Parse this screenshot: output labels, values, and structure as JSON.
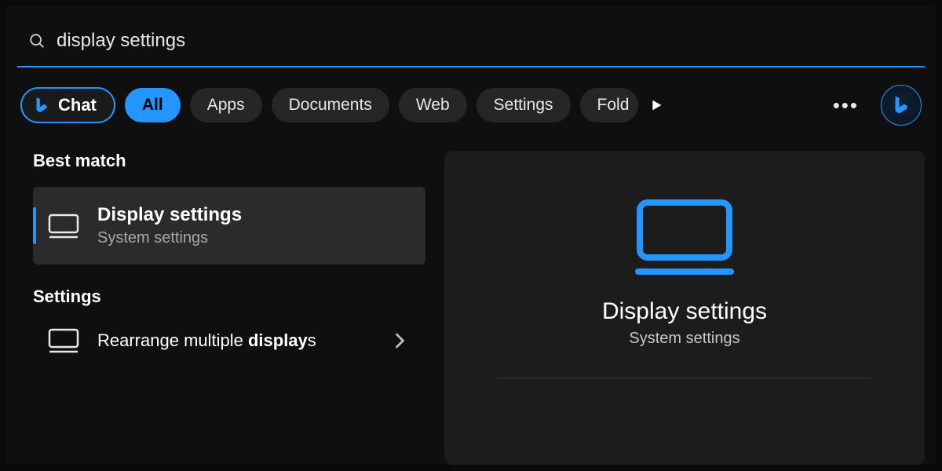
{
  "search": {
    "query": "display settings"
  },
  "filters": {
    "chat_label": "Chat",
    "tabs": [
      "All",
      "Apps",
      "Documents",
      "Web",
      "Settings",
      "Fold"
    ]
  },
  "sections": {
    "best_match_label": "Best match",
    "settings_label": "Settings"
  },
  "best_match": {
    "title": "Display settings",
    "subtitle": "System settings"
  },
  "settings_results": {
    "item1_prefix": "Rearrange multiple ",
    "item1_bold": "display",
    "item1_suffix": "s"
  },
  "detail": {
    "title": "Display settings",
    "subtitle": "System settings"
  },
  "colors": {
    "accent": "#2596ff"
  }
}
